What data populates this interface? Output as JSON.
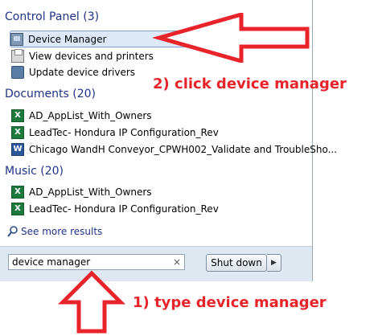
{
  "groups": {
    "control_panel": {
      "title": "Control Panel (3)",
      "items": [
        {
          "label": "Device Manager",
          "icon": "device-manager-icon"
        },
        {
          "label": "View devices and printers",
          "icon": "printer-icon"
        },
        {
          "label": "Update device drivers",
          "icon": "driver-icon"
        }
      ]
    },
    "documents": {
      "title": "Documents (20)",
      "items": [
        {
          "label": "AD_AppList_With_Owners",
          "icon": "excel-icon"
        },
        {
          "label": "LeadTec- Hondura IP Configuration_Rev",
          "icon": "excel-icon"
        },
        {
          "label": "Chicago WandH Conveyor_CPWH002_Validate and TroubleSho...",
          "icon": "word-icon"
        }
      ]
    },
    "music": {
      "title": "Music (20)",
      "items": [
        {
          "label": "AD_AppList_With_Owners",
          "icon": "excel-icon"
        },
        {
          "label": "LeadTec- Hondura IP Configuration_Rev",
          "icon": "excel-icon"
        }
      ]
    }
  },
  "see_more": "See more results",
  "search": {
    "value": "device manager",
    "clear": "×"
  },
  "shutdown": {
    "label": "Shut down",
    "arrow": "▶"
  },
  "annotations": {
    "step2": "2) click device manager",
    "step1": "1) type device manager"
  },
  "colors": {
    "annotation": "#e8232a",
    "group_heading": "#1e3287",
    "selected_bg": "#dde9f8"
  }
}
